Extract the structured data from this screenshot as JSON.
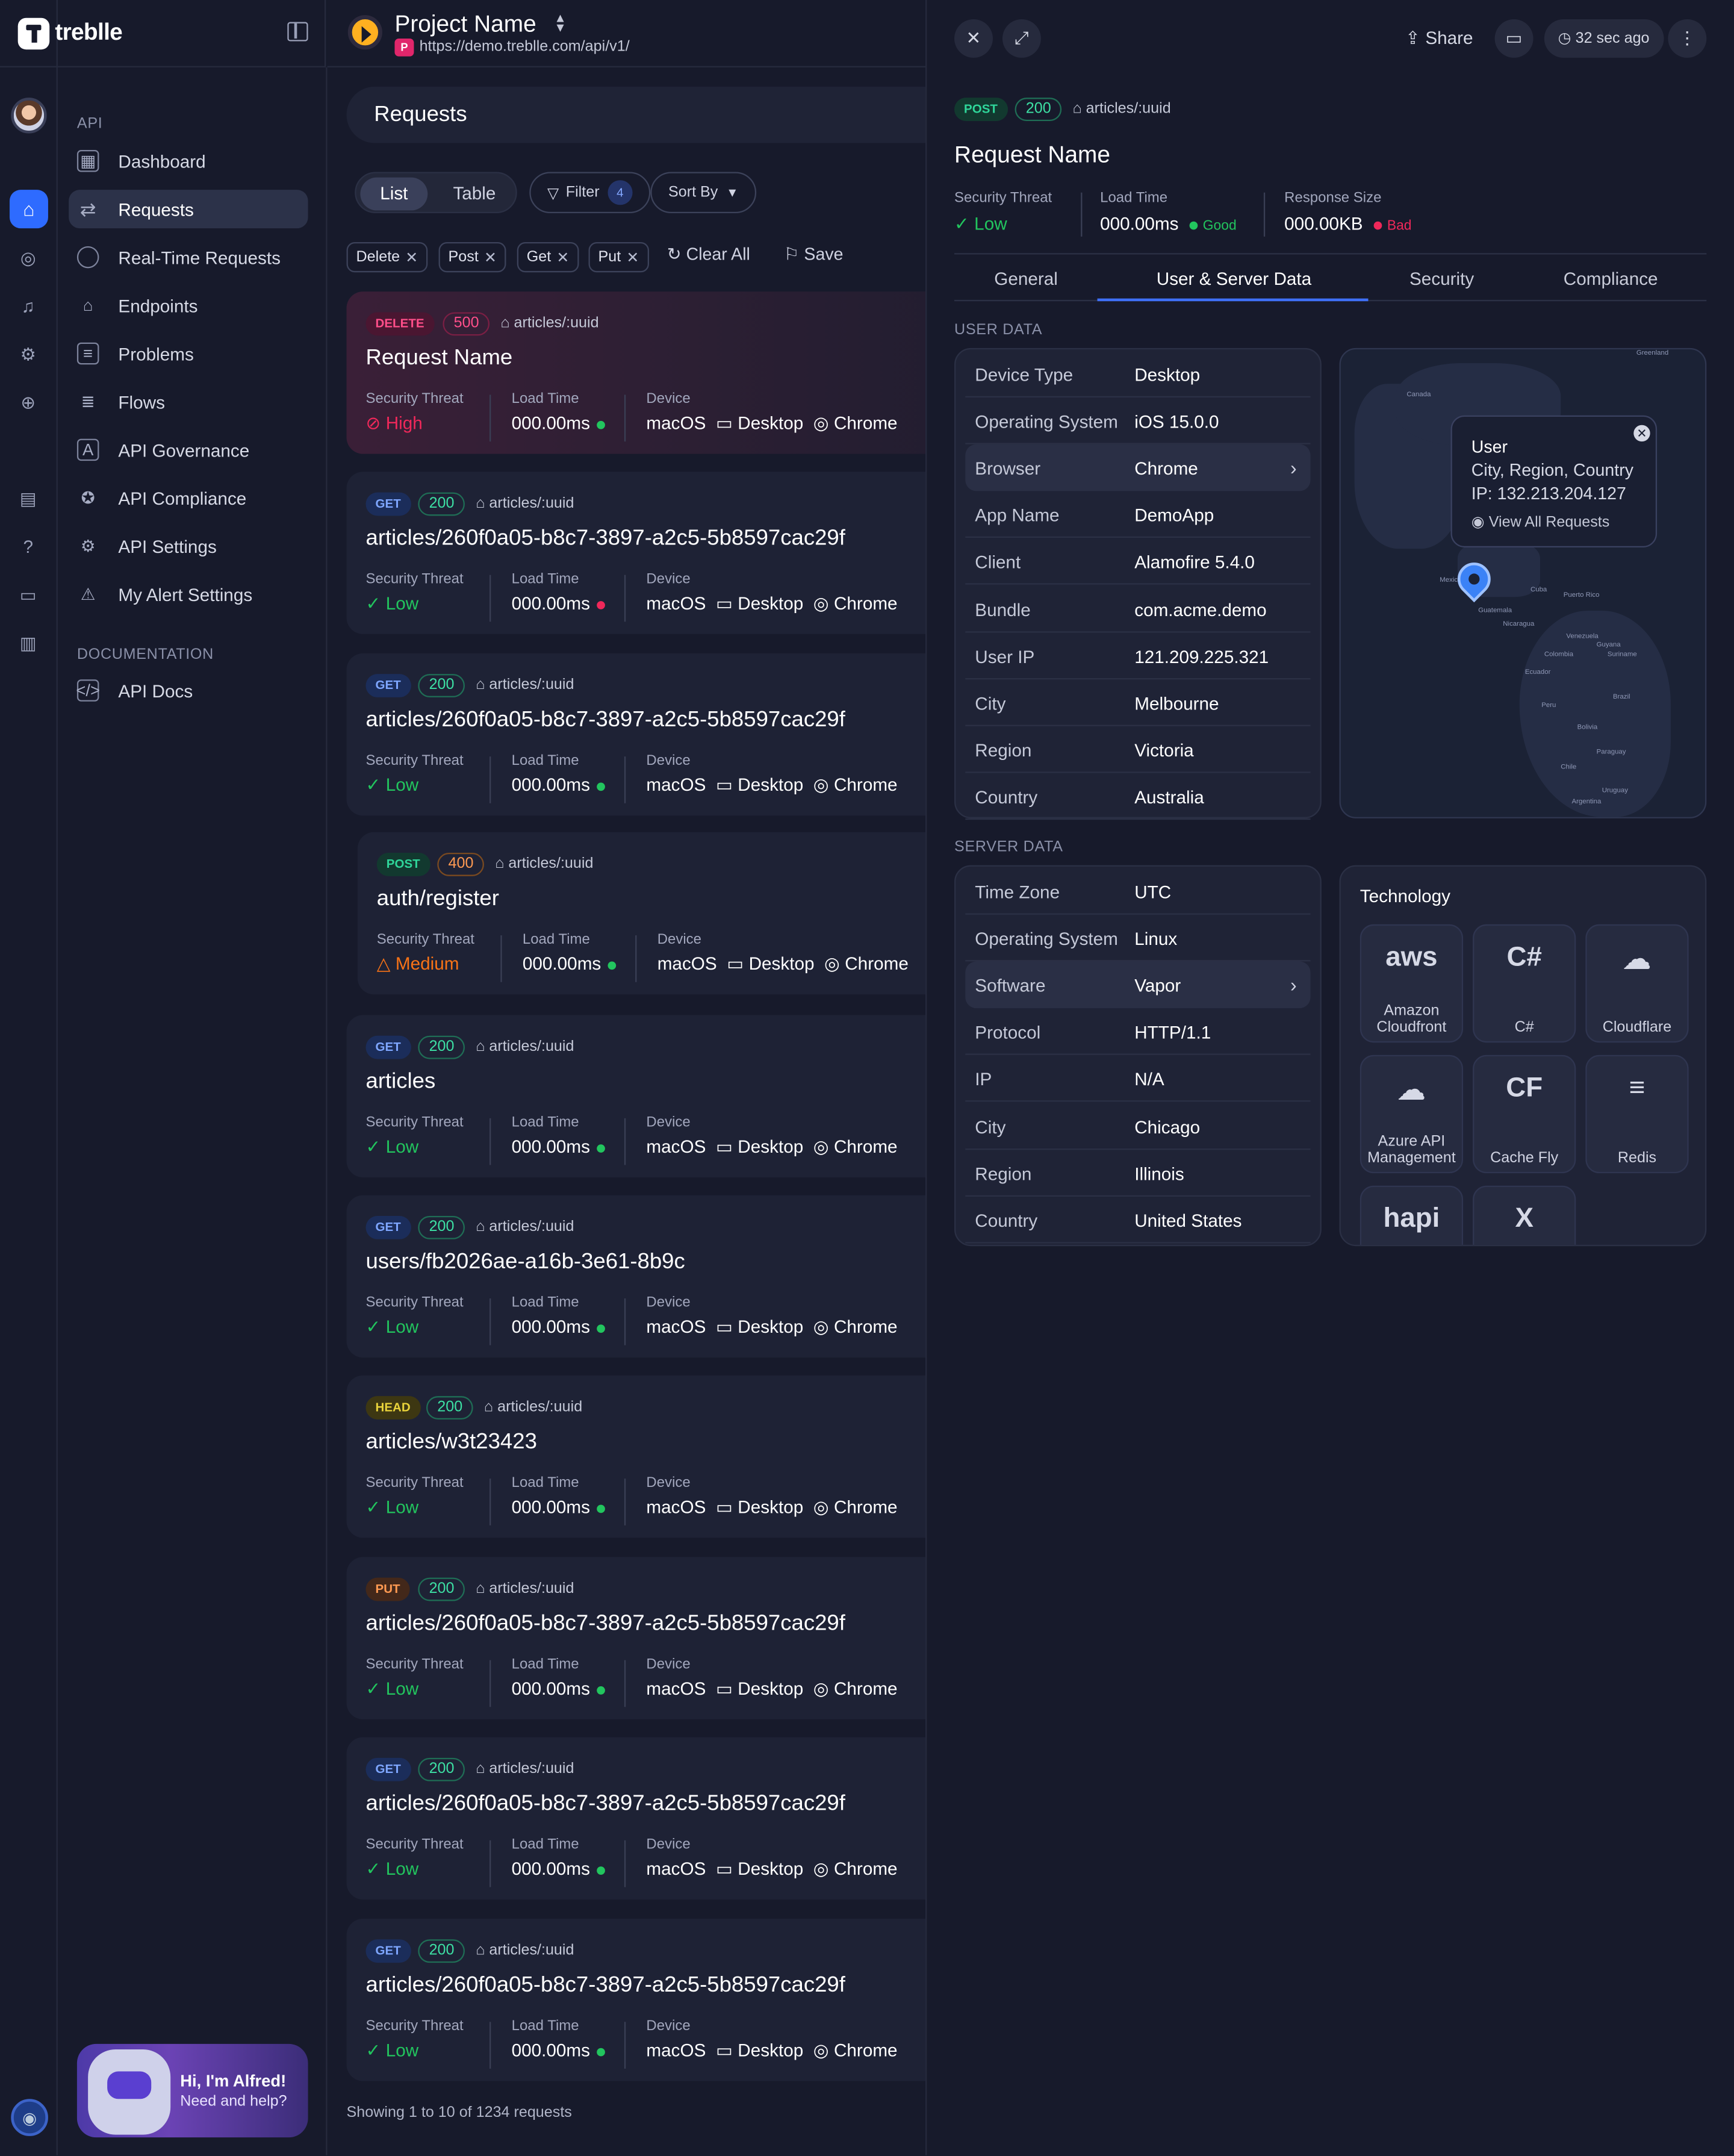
{
  "brand": {
    "name": "treblle"
  },
  "sidebar": {
    "section_api": "API",
    "section_docs": "DOCUMENTATION",
    "items": [
      {
        "label": "Dashboard",
        "icon": "grid-icon"
      },
      {
        "label": "Requests",
        "icon": "arrows-icon"
      },
      {
        "label": "Real-Time Requests",
        "icon": "timer-icon"
      },
      {
        "label": "Endpoints",
        "icon": "endpoints-icon"
      },
      {
        "label": "Problems",
        "icon": "list-icon"
      },
      {
        "label": "Flows",
        "icon": "flows-icon"
      },
      {
        "label": "API Governance",
        "icon": "governance-icon"
      },
      {
        "label": "API Compliance",
        "icon": "compliance-icon"
      },
      {
        "label": "API Settings",
        "icon": "gear-icon"
      },
      {
        "label": "My Alert Settings",
        "icon": "alert-icon"
      }
    ],
    "docs": [
      {
        "label": "API Docs",
        "icon": "docs-icon"
      }
    ],
    "alfred": {
      "title": "Hi, I'm Alfred!",
      "subtitle": "Need and help?"
    }
  },
  "project": {
    "name": "Project Name",
    "badge": "P",
    "url": "https://demo.treblle.com/api/v1/"
  },
  "requests": {
    "title": "Requests",
    "view_list": "List",
    "view_table": "Table",
    "filter_label": "Filter",
    "filter_count": "4",
    "sort_label": "Sort By",
    "chips": [
      "Delete",
      "Post",
      "Get",
      "Put"
    ],
    "clear_all": "Clear All",
    "save": "Save",
    "labels": {
      "threat": "Security Threat",
      "load": "Load Time",
      "device": "Device"
    },
    "device": {
      "os": "macOS",
      "type": "Desktop",
      "browser": "Chrome"
    },
    "cards": [
      {
        "method": "DELETE",
        "code": "500",
        "path": "articles/:uuid",
        "name": "Request Name",
        "threat": "High",
        "load": "000.00ms",
        "dot": "green"
      },
      {
        "method": "GET",
        "code": "200",
        "path": "articles/:uuid",
        "name": "articles/260f0a05-b8c7-3897-a2c5-5b8597cac29f",
        "threat": "Low",
        "load": "000.00ms",
        "dot": "red"
      },
      {
        "method": "GET",
        "code": "200",
        "path": "articles/:uuid",
        "name": "articles/260f0a05-b8c7-3897-a2c5-5b8597cac29f",
        "threat": "Low",
        "load": "000.00ms",
        "dot": "green"
      },
      {
        "method": "POST",
        "code": "400",
        "path": "articles/:uuid",
        "name": "auth/register",
        "threat": "Medium",
        "load": "000.00ms",
        "dot": "green"
      },
      {
        "method": "GET",
        "code": "200",
        "path": "articles/:uuid",
        "name": "articles",
        "threat": "Low",
        "load": "000.00ms",
        "dot": "green"
      },
      {
        "method": "GET",
        "code": "200",
        "path": "articles/:uuid",
        "name": "users/fb2026ae-a16b-3e61-8b9c",
        "threat": "Low",
        "load": "000.00ms",
        "dot": "green"
      },
      {
        "method": "HEAD",
        "code": "200",
        "path": "articles/:uuid",
        "name": "articles/w3t23423",
        "threat": "Low",
        "load": "000.00ms",
        "dot": "green"
      },
      {
        "method": "PUT",
        "code": "200",
        "path": "articles/:uuid",
        "name": "articles/260f0a05-b8c7-3897-a2c5-5b8597cac29f",
        "threat": "Low",
        "load": "000.00ms",
        "dot": "green"
      },
      {
        "method": "GET",
        "code": "200",
        "path": "articles/:uuid",
        "name": "articles/260f0a05-b8c7-3897-a2c5-5b8597cac29f",
        "threat": "Low",
        "load": "000.00ms",
        "dot": "green"
      },
      {
        "method": "GET",
        "code": "200",
        "path": "articles/:uuid",
        "name": "articles/260f0a05-b8c7-3897-a2c5-5b8597cac29f",
        "threat": "Low",
        "load": "000.00ms",
        "dot": "green"
      }
    ],
    "footer": "Showing 1 to 10 of 1234 requests"
  },
  "detail": {
    "share": "Share",
    "ago": "32 sec ago",
    "method": "POST",
    "code": "200",
    "path": "articles/:uuid",
    "title": "Request Name",
    "threat_label": "Security Threat",
    "threat_value": "Low",
    "load_label": "Load Time",
    "load_value": "000.00ms",
    "load_status": "Good",
    "size_label": "Response Size",
    "size_value": "000.00KB",
    "size_status": "Bad",
    "tabs": [
      "General",
      "User & Server Data",
      "Security",
      "Compliance"
    ],
    "user_section": "USER DATA",
    "user_rows": [
      [
        "Device Type",
        "Desktop"
      ],
      [
        "Operating System",
        "iOS 15.0.0"
      ],
      [
        "Browser",
        "Chrome"
      ],
      [
        "App Name",
        "DemoApp"
      ],
      [
        "Client",
        "Alamofire 5.4.0"
      ],
      [
        "Bundle",
        "com.acme.demo"
      ],
      [
        "User IP",
        "121.209.225.321"
      ],
      [
        "City",
        "Melbourne"
      ],
      [
        "Region",
        "Victoria"
      ],
      [
        "Country",
        "Australia"
      ]
    ],
    "server_section": "SERVER DATA",
    "server_rows": [
      [
        "Time Zone",
        "UTC"
      ],
      [
        "Operating System",
        "Linux"
      ],
      [
        "Software",
        "Vapor"
      ],
      [
        "Protocol",
        "HTTP/1.1"
      ],
      [
        "IP",
        "N/A"
      ],
      [
        "City",
        "Chicago"
      ],
      [
        "Region",
        "Illinois"
      ],
      [
        "Country",
        "United States"
      ]
    ],
    "map": {
      "tooltip_title": "User",
      "tooltip_location": "City, Region, Country",
      "tooltip_ip": "IP: 132.213.204.127",
      "tooltip_link": "View All Requests",
      "labels": [
        "Greenland",
        "Canada",
        "Mexico",
        "Cuba",
        "Puerto Rico",
        "Guatemala",
        "Nicaragua",
        "Venezuela",
        "Guyana",
        "Suriname",
        "Colombia",
        "Ecuador",
        "Brazil",
        "Peru",
        "Bolivia",
        "Paraguay",
        "Chile",
        "Uruguay",
        "Argentina"
      ]
    },
    "technology": {
      "title": "Technology",
      "items": [
        {
          "label": "Amazon Cloudfront",
          "icon": "amazon-cloudfront-icon"
        },
        {
          "label": "C#",
          "icon": "csharp-icon"
        },
        {
          "label": "Cloudflare",
          "icon": "cloudflare-icon"
        },
        {
          "label": "Azure API Management",
          "icon": "azure-api-icon"
        },
        {
          "label": "Cache Fly",
          "icon": "cachefly-icon"
        },
        {
          "label": "Redis",
          "icon": "redis-icon"
        },
        {
          "label": "",
          "icon": "hapi-icon"
        },
        {
          "label": "",
          "icon": "x-icon"
        }
      ]
    }
  },
  "colors": {
    "bg": "#171a2b",
    "card": "#1e2235",
    "accent": "#2e6bff",
    "green": "#22c55e",
    "red": "#f0285a",
    "orange": "#f97316"
  }
}
